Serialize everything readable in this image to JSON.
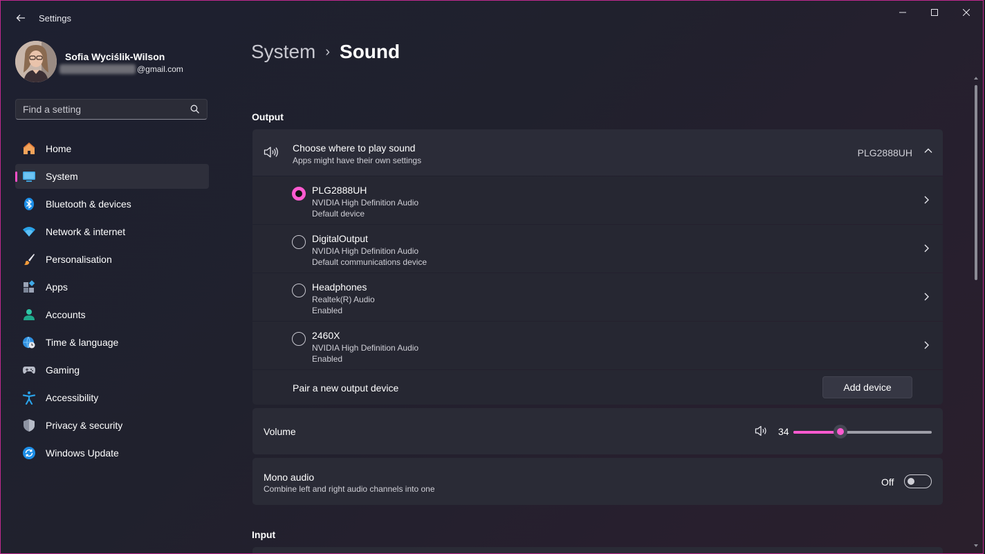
{
  "app": {
    "title": "Settings"
  },
  "profile": {
    "name": "Sofia Wyciślik-Wilson",
    "email_domain": "@gmail.com"
  },
  "search": {
    "placeholder": "Find a setting"
  },
  "nav": {
    "items": [
      {
        "label": "Home",
        "icon": "home-icon"
      },
      {
        "label": "System",
        "icon": "system-icon",
        "active": true
      },
      {
        "label": "Bluetooth & devices",
        "icon": "bluetooth-icon"
      },
      {
        "label": "Network & internet",
        "icon": "wifi-icon"
      },
      {
        "label": "Personalisation",
        "icon": "brush-icon"
      },
      {
        "label": "Apps",
        "icon": "apps-icon"
      },
      {
        "label": "Accounts",
        "icon": "person-icon"
      },
      {
        "label": "Time & language",
        "icon": "globe-clock-icon"
      },
      {
        "label": "Gaming",
        "icon": "gamepad-icon"
      },
      {
        "label": "Accessibility",
        "icon": "accessibility-icon"
      },
      {
        "label": "Privacy & security",
        "icon": "shield-icon"
      },
      {
        "label": "Windows Update",
        "icon": "update-icon"
      }
    ]
  },
  "breadcrumb": {
    "parent": "System",
    "separator": "›",
    "current": "Sound"
  },
  "output": {
    "section_title": "Output",
    "choose_title": "Choose where to play sound",
    "choose_sub": "Apps might have their own settings",
    "selected_device": "PLG2888UH",
    "devices": [
      {
        "name": "PLG2888UH",
        "driver": "NVIDIA High Definition Audio",
        "status": "Default device",
        "selected": true
      },
      {
        "name": "DigitalOutput",
        "driver": "NVIDIA High Definition Audio",
        "status": "Default communications device",
        "selected": false
      },
      {
        "name": "Headphones",
        "driver": "Realtek(R) Audio",
        "status": "Enabled",
        "selected": false
      },
      {
        "name": "2460X",
        "driver": "NVIDIA High Definition Audio",
        "status": "Enabled",
        "selected": false
      }
    ],
    "pair_label": "Pair a new output device",
    "add_device_label": "Add device"
  },
  "volume": {
    "label": "Volume",
    "value": "34",
    "level_fraction": 0.34
  },
  "mono": {
    "title": "Mono audio",
    "subtitle": "Combine left and right audio channels into one",
    "state_label": "Off",
    "enabled": false
  },
  "input": {
    "section_title": "Input"
  },
  "colors": {
    "accent": "#ff5ad0",
    "window_border": "#c0298f"
  }
}
